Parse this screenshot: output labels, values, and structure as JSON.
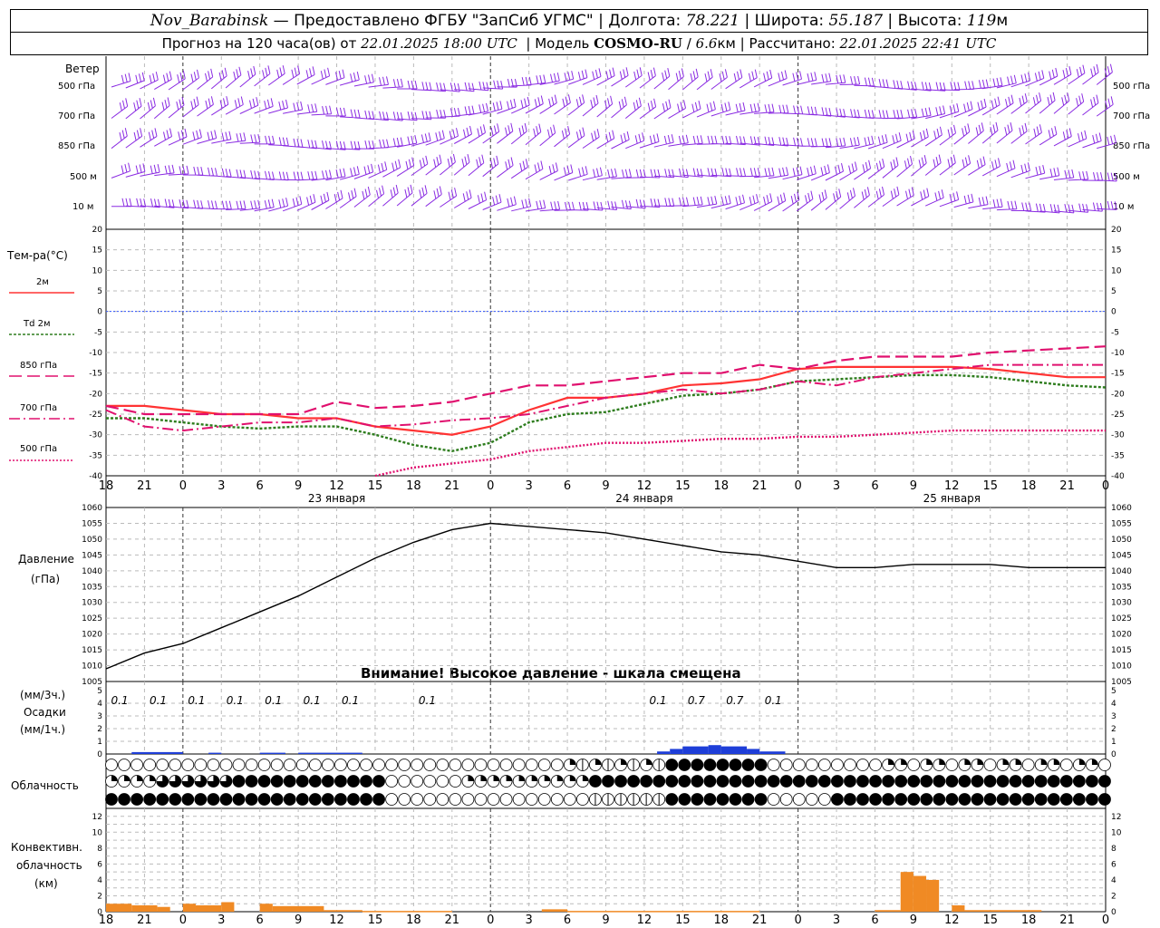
{
  "header": {
    "station": "Nov_Barabinsk",
    "provider": "Предоставлено ФГБУ \"ЗапСиб УГМС\"",
    "lon_label": "Долгота:",
    "lon": "78.221",
    "lat_label": "Широта:",
    "lat": "55.187",
    "alt_label": "Высота:",
    "alt": "119",
    "alt_unit": "м"
  },
  "header2": {
    "forecast_prefix": "Прогноз на 120 часа(ов) от",
    "forecast_time": "22.01.2025 18:00 UTC",
    "model_label": "Модель",
    "model": "COSMO-RU",
    "resolution": "6.6",
    "res_unit": "км",
    "calc_label": "Рассчитано:",
    "calc_time": "22.01.2025 22:41 UTC"
  },
  "wind": {
    "title": "Ветер",
    "levels": [
      "500 гПа",
      "700 гПа",
      "850 гПа",
      "500 м",
      "10 м"
    ]
  },
  "temp_panel": {
    "title": "Тем-ра(°C)",
    "legend": [
      {
        "label": "2м",
        "color": "#ff3333"
      },
      {
        "label": "Td 2м",
        "color": "#2e7d1e"
      },
      {
        "label": "850 гПа",
        "color": "#e0106e"
      },
      {
        "label": "700 гПа",
        "color": "#e0106e"
      },
      {
        "label": "500 гПа",
        "color": "#e0106e"
      }
    ]
  },
  "pressure_panel": {
    "title": "Давление",
    "unit": "(гПа)",
    "warning": "Внимание! Высокое давление - шкала смещена"
  },
  "precip_panel": {
    "unit3": "(мм/3ч.)",
    "title": "Осадки",
    "unit1": "(мм/1ч.)"
  },
  "cloud_panel": {
    "title": "Облачность"
  },
  "conv_panel": {
    "title1": "Конвективн.",
    "title2": "облачность",
    "unit": "(км)"
  },
  "time_axis": {
    "hour_labels": [
      "18",
      "21",
      "0",
      "3",
      "6",
      "9",
      "12",
      "15",
      "18",
      "21",
      "0",
      "3",
      "6",
      "9",
      "12",
      "15",
      "18",
      "21",
      "0",
      "3",
      "6",
      "9",
      "12",
      "15",
      "18",
      "21",
      "0"
    ],
    "dates": [
      "23 января",
      "24 января",
      "25 января"
    ]
  },
  "colors": {
    "wind": "#8a2be2",
    "t2m": "#ff3333",
    "td2m": "#2e7d1e",
    "upper": "#e0106e",
    "precip": "#1e3ed8",
    "conv": "#f08a24",
    "zero": "#3355ff"
  },
  "chart_data": [
    {
      "type": "line",
      "title": "Тем-ра(°C)",
      "ylim": [
        -40,
        20
      ],
      "x_hours": [
        0,
        3,
        6,
        9,
        12,
        15,
        18,
        21,
        24,
        27,
        30,
        33,
        36,
        39,
        42,
        45,
        48,
        51,
        54,
        57,
        60,
        63,
        66,
        69,
        72,
        75,
        78
      ],
      "series": [
        {
          "name": "2м",
          "values": [
            -23,
            -23,
            -24,
            -25,
            -25,
            -26,
            -26,
            -28,
            -29,
            -30,
            -28,
            -24,
            -21,
            -21,
            -20,
            -18,
            -17.5,
            -16.5,
            -14,
            -13.5,
            -13.5,
            -13.5,
            -13.5,
            -14,
            -15,
            -16,
            -16
          ]
        },
        {
          "name": "Td 2м",
          "values": [
            -26,
            -26,
            -27,
            -28,
            -28.5,
            -28,
            -28,
            -30,
            -32.5,
            -34,
            -32,
            -27,
            -25,
            -24.5,
            -22.5,
            -20.5,
            -20,
            -19,
            -17,
            -16.5,
            -16,
            -15.5,
            -15.5,
            -16,
            -17,
            -18,
            -18.5
          ]
        },
        {
          "name": "850 гПа",
          "values": [
            -23,
            -25,
            -25,
            -25,
            -25,
            -25,
            -22,
            -23.5,
            -23,
            -22,
            -20,
            -18,
            -18,
            -17,
            -16,
            -15,
            -15,
            -13,
            -14,
            -12,
            -11,
            -11,
            -11,
            -10,
            -9.5,
            -9,
            -8.5
          ]
        },
        {
          "name": "700 гПа",
          "values": [
            -24,
            -28,
            -29,
            -28,
            -27,
            -27,
            -26,
            -28,
            -27.5,
            -26.5,
            -26,
            -25,
            -23,
            -21,
            -20,
            -19,
            -20,
            -19,
            -17,
            -18,
            -16,
            -15,
            -14,
            -13,
            -13,
            -13,
            -13
          ]
        },
        {
          "name": "500 гПа",
          "values": [
            null,
            null,
            null,
            null,
            null,
            null,
            null,
            -40,
            -38,
            -37,
            -36,
            -34,
            -33,
            -32,
            -32,
            -31.5,
            -31,
            -31,
            -30.5,
            -30.5,
            -30,
            -29.5,
            -29,
            -29,
            -29,
            -29,
            -29
          ]
        }
      ]
    },
    {
      "type": "line",
      "title": "Давление",
      "unit": "(гПа)",
      "ylim": [
        1005,
        1060
      ],
      "x_hours": [
        0,
        3,
        6,
        9,
        12,
        15,
        18,
        21,
        24,
        27,
        30,
        33,
        36,
        39,
        42,
        45,
        48,
        51,
        54,
        57,
        60,
        63,
        66,
        69,
        72,
        75,
        78
      ],
      "series": [
        {
          "name": "",
          "values": [
            1009,
            1014,
            1017,
            1022,
            1027,
            1032,
            1038,
            1044,
            1049,
            1053,
            1055,
            1054,
            1053,
            1052,
            1050,
            1048,
            1046,
            1045,
            1043,
            1041,
            1041,
            1042,
            1042,
            1042,
            1041,
            1041,
            1041
          ]
        }
      ]
    },
    {
      "type": "bar",
      "title": "Осадки",
      "ylim": [
        0,
        5
      ],
      "labels": [
        {
          "hour": 0.5,
          "text": "0.1"
        },
        {
          "hour": 3.5,
          "text": "0.1"
        },
        {
          "hour": 6.5,
          "text": "0.1"
        },
        {
          "hour": 9.5,
          "text": "0.1"
        },
        {
          "hour": 12.5,
          "text": "0.1"
        },
        {
          "hour": 15.5,
          "text": "0.1"
        },
        {
          "hour": 18.5,
          "text": "0.1"
        },
        {
          "hour": 24.5,
          "text": "0.1"
        },
        {
          "hour": 42.5,
          "text": "0.1"
        },
        {
          "hour": 45.5,
          "text": "0.7"
        },
        {
          "hour": 48.5,
          "text": "0.7"
        },
        {
          "hour": 51.5,
          "text": "0.1"
        }
      ],
      "bars": [
        {
          "from": 2,
          "to": 6,
          "value": 0.15
        },
        {
          "from": 8,
          "to": 9,
          "value": 0.1
        },
        {
          "from": 12,
          "to": 14,
          "value": 0.1
        },
        {
          "from": 15,
          "to": 20,
          "value": 0.1
        },
        {
          "from": 43,
          "to": 44,
          "value": 0.2
        },
        {
          "from": 44,
          "to": 45,
          "value": 0.4
        },
        {
          "from": 45,
          "to": 47,
          "value": 0.6
        },
        {
          "from": 47,
          "to": 48,
          "value": 0.7
        },
        {
          "from": 48,
          "to": 50,
          "value": 0.6
        },
        {
          "from": 50,
          "to": 51,
          "value": 0.4
        },
        {
          "from": 51,
          "to": 53,
          "value": 0.2
        }
      ]
    },
    {
      "type": "bar",
      "title": "Конвективн. облачность",
      "unit": "(км)",
      "ylim": [
        0,
        12
      ],
      "bars": [
        {
          "from": 0,
          "to": 2,
          "value": 1
        },
        {
          "from": 2,
          "to": 4,
          "value": 0.8
        },
        {
          "from": 4,
          "to": 5,
          "value": 0.6
        },
        {
          "from": 6,
          "to": 7,
          "value": 1
        },
        {
          "from": 7,
          "to": 9,
          "value": 0.8
        },
        {
          "from": 9,
          "to": 10,
          "value": 1.2
        },
        {
          "from": 12,
          "to": 13,
          "value": 1
        },
        {
          "from": 13,
          "to": 17,
          "value": 0.7
        },
        {
          "from": 17,
          "to": 20,
          "value": 0.2
        },
        {
          "from": 20,
          "to": 27,
          "value": 0.1
        },
        {
          "from": 34,
          "to": 36,
          "value": 0.3
        },
        {
          "from": 36,
          "to": 51,
          "value": 0.1
        },
        {
          "from": 60,
          "to": 62,
          "value": 0.2
        },
        {
          "from": 62,
          "to": 63,
          "value": 5
        },
        {
          "from": 63,
          "to": 64,
          "value": 4.5
        },
        {
          "from": 64,
          "to": 65,
          "value": 4
        },
        {
          "from": 66,
          "to": 67,
          "value": 0.8
        },
        {
          "from": 67,
          "to": 73,
          "value": 0.2
        }
      ]
    }
  ]
}
